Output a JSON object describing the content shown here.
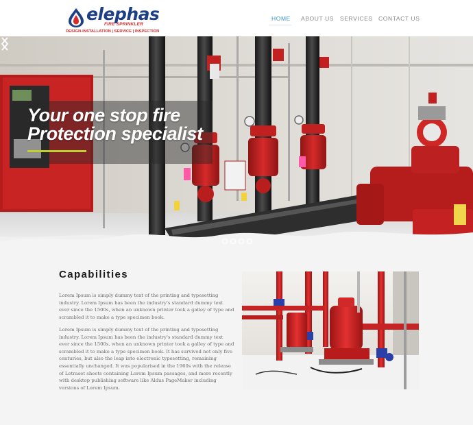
{
  "brand": {
    "name": "elephas",
    "subtitle": "FIRE SPRINKLER",
    "tagline": "DESIGN-INSTALLATION | SERVICE | INSPECTION",
    "primary_color": "#1d3f86",
    "accent_color": "#d92b2b"
  },
  "nav": {
    "items": [
      {
        "label": "HOME",
        "active": true
      },
      {
        "label": "ABOUT US",
        "active": false
      },
      {
        "label": "SERVICES",
        "active": false
      },
      {
        "label": "CONTACT US",
        "active": false
      }
    ],
    "active_color": "#3d93c9",
    "inactive_color": "#8a8a8a"
  },
  "hero": {
    "headline_line1": "Your one stop fire",
    "headline_line2": "Protection specialist",
    "prev_icon": "chevron-left-icon",
    "next_icon": "chevron-right-icon",
    "slide_count": 4,
    "accent_bar_color": "#bfcf2f"
  },
  "capabilities": {
    "title": "Capabilities",
    "paragraph1": "Lorem Ipsum is simply dummy text of the printing and typesetting industry. Lorem Ipsum has been the industry's standard dummy text ever since the 1500s, when an unknown printer took a galley of type and scrambled it to make a type specimen book.",
    "paragraph2": "Lorem Ipsum is simply dummy text of the printing and typesetting industry. Lorem Ipsum has been the industry's standard dummy text ever since the 1500s, when an unknown printer took a galley of type and scrambled it to make a type specimen book. It has survived not only five centuries, but also the leap into electronic typesetting, remaining essentially unchanged. It was popularised in the 1960s with the release of Letraset sheets containing Lorem Ipsum passages, and more recently with desktop publishing software like Aldus PageMaker including versions of Lorem Ipsum."
  }
}
